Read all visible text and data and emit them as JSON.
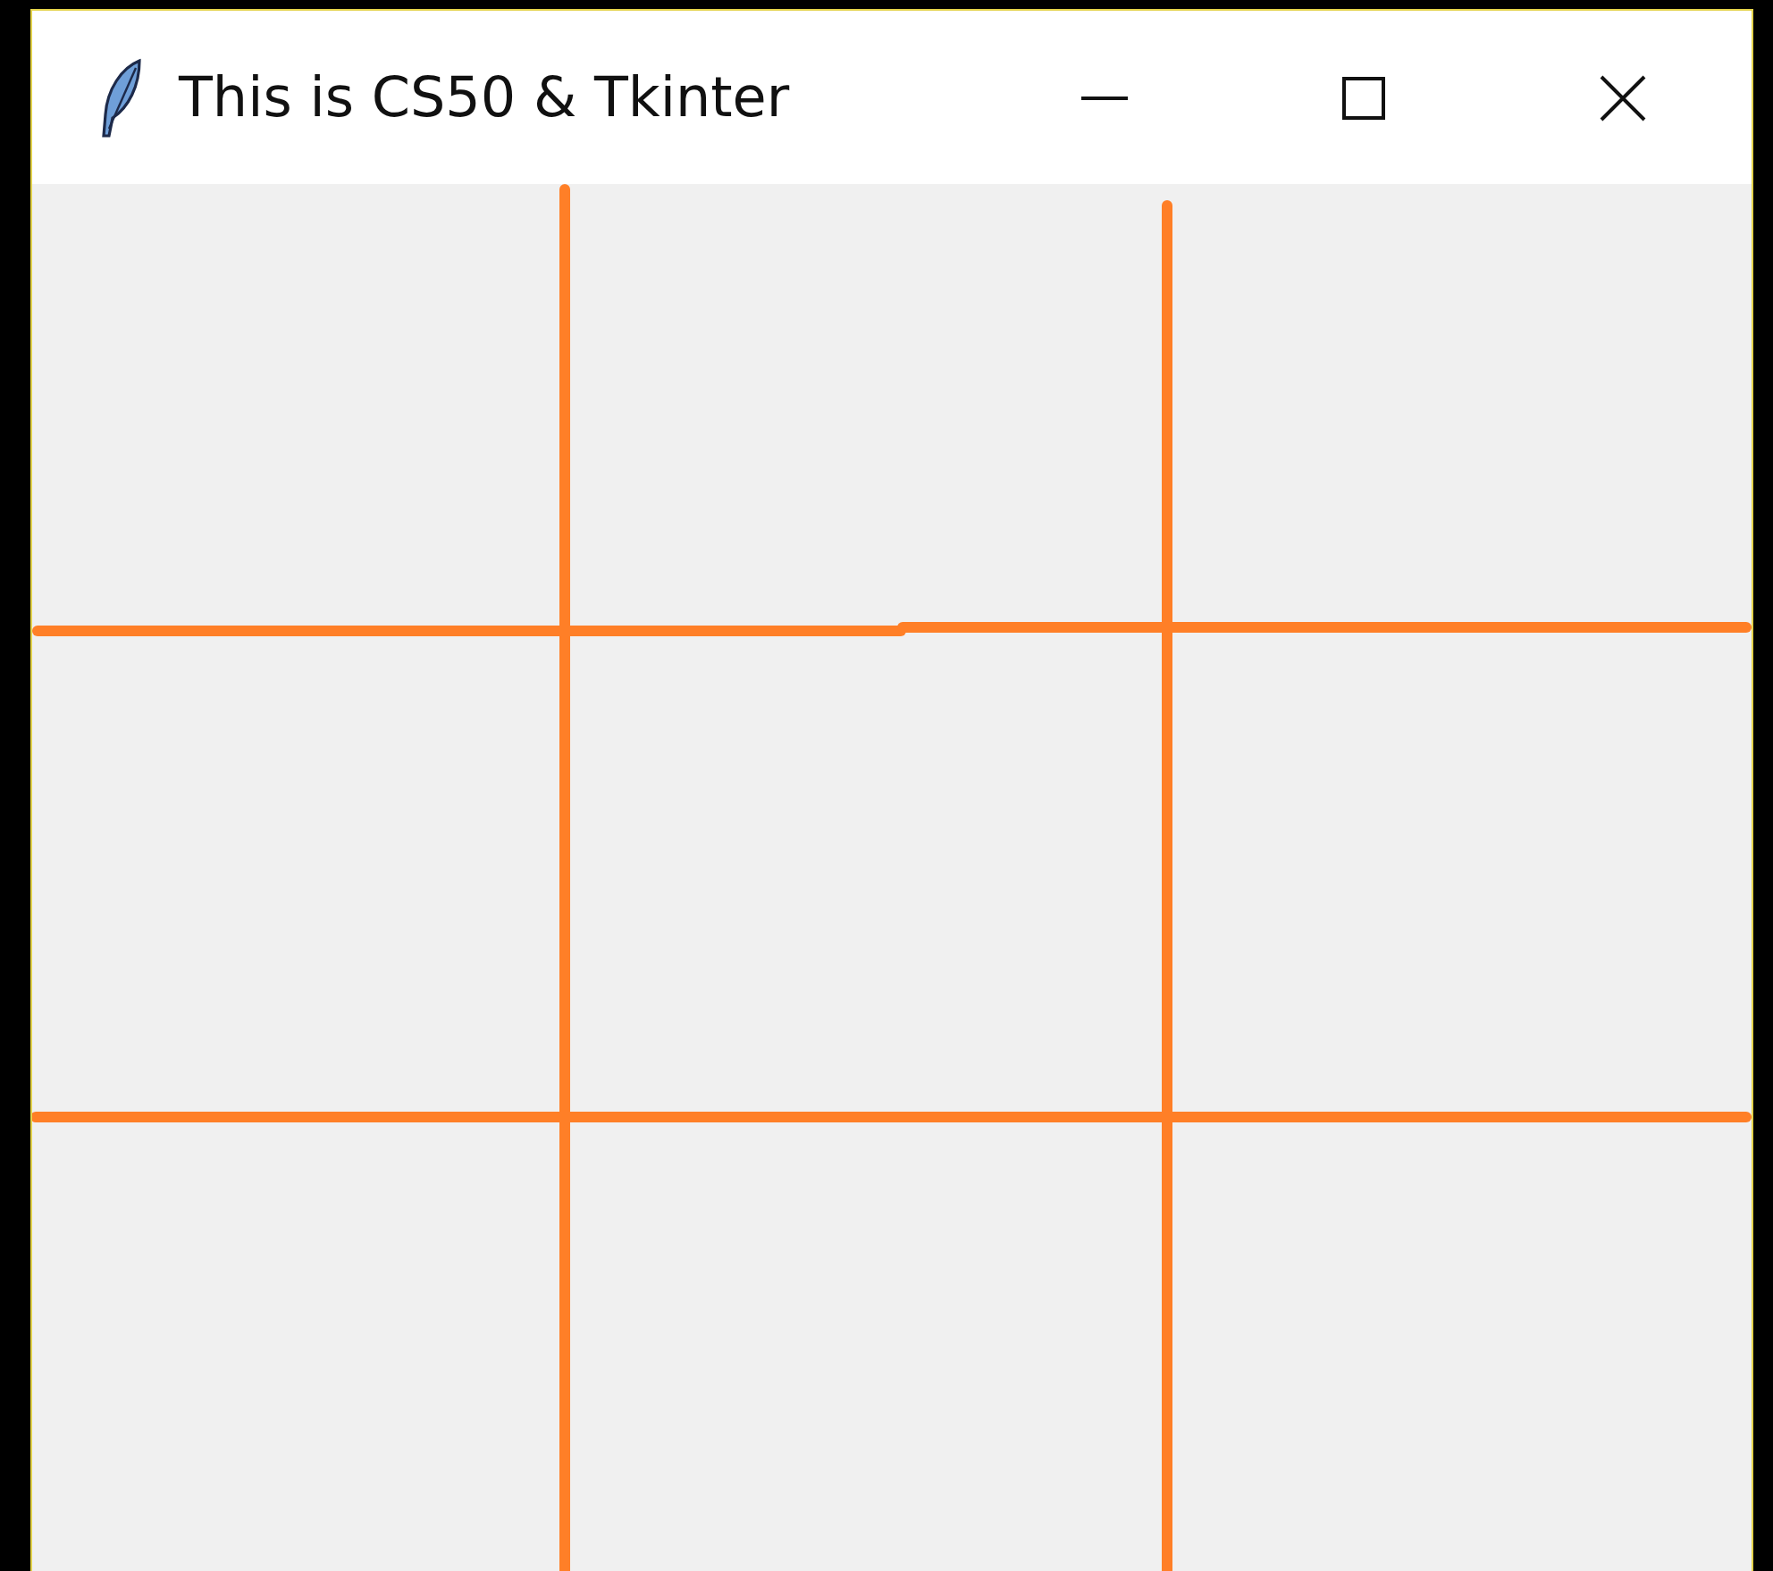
{
  "window": {
    "title": "This is CS50 & Tkinter"
  }
}
